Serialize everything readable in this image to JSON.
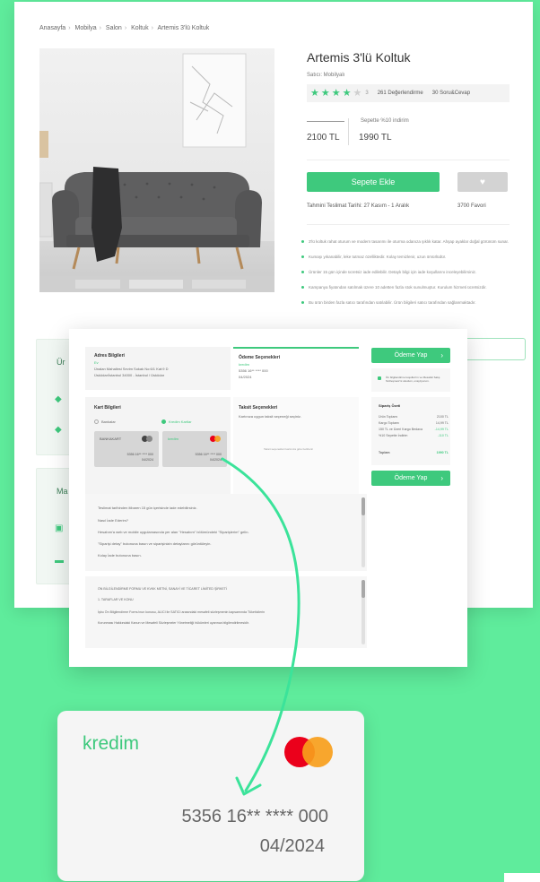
{
  "breadcrumb": [
    "Anasayfa",
    "Mobilya",
    "Salon",
    "Koltuk",
    "Artemis 3'lü Koltuk"
  ],
  "product": {
    "title": "Artemis 3'lü Koltuk",
    "seller": "Satıcı: Mobilyalı",
    "rating": 4,
    "rating_value": "3",
    "reviews_link": "261 Değerlendirme",
    "qa_link": "30 Soru&Cevap",
    "discount_label": "Sepette %10 indirim",
    "price_old": "2100 TL",
    "price_new": "1990 TL",
    "add_to_cart": "Sepete Ekle",
    "delivery": "Tahmini Teslimat Tarihi: 27 Kasım - 1 Aralık",
    "stock": "3700 Favori",
    "features": [
      "3'lü koltuk rahat oturum ve modern tasarımı ile oturma odanıza şıklık katar. Ahşap ayaklar doğal görünüm sunar.",
      "Kumaşı yıkanabilir, leke tutmaz özelliktedir. Kolay temizlenir, uzun ömürlüdür.",
      "Ürünler 15 gün içinde ücretsiz iade edilebilir. Detaylı bilgi için iade koşullarını inceleyebilirsiniz.",
      "Kampanya fiyatından satılmak üzere 10 adetten fazla stok sunulmuştur. Kurulum hizmeti ücretsizdir.",
      "Bu ürün birden fazla satıcı tarafından satılabilir. Ürün bilgileri satıcı tarafından sağlanmaktadır."
    ]
  },
  "side": {
    "box1_label": "Ür",
    "box2_label": "Ma"
  },
  "checkout": {
    "address_title": "Adres Bilgileri",
    "address_name": "Ev",
    "address_line1": "Ünalan Mahallesi Sevim Sokak No:6/1 Kat:9 D",
    "address_line2": "Üsküdar/İstanbul 34000 - İstanbul / Üsküdar",
    "payment_title": "Ödeme Seçenekleri",
    "payment_brand": "kredim",
    "payment_num": "5356 16** **** 000",
    "payment_date": "04/2024",
    "pay_button": "Ödeme Yap",
    "agree_text": "Ön bilgilendirme koşulları'nı ve Mesafeli Satış Sözleşmesi'ni okudum, onaylıyorum.",
    "card_title": "Kart Bilgileri",
    "opt1": "Bankalar",
    "opt2": "Kredim Kartlar",
    "cardA_brand": "BANKAKART",
    "cardA_num": "5356 16** **** 000",
    "cardA_date": "04/2024",
    "cardB_brand": "kredim",
    "cardB_num": "5356 16** **** 000",
    "cardB_date": "04/2024",
    "install_title": "Taksit Seçenekleri",
    "install_text": "Kartınıza uygun taksit seçeneği seçiniz.",
    "install_hint": "Taksit seçenekleri kartınıza göre belirlenir",
    "summary_title": "Sipariş Özeti",
    "summary_rows": [
      {
        "label": "Ürün Toplamı",
        "value": "2100 TL",
        "green": false
      },
      {
        "label": "Kargo Toplamı",
        "value": "14,99 TL",
        "green": false
      },
      {
        "label": "150 TL ve Üzeri Kargo Bedava",
        "value": "-14,99 TL",
        "green": true
      },
      {
        "label": "%10 Sepette İndirim",
        "value": "-110 TL",
        "green": true
      }
    ],
    "total_label": "Toplam",
    "total_value": "1990 TL",
    "info_lines": [
      "Teslimat tarihinden itibaren 15 gün içerisinde iade edebilirsiniz.",
      "Nasıl İade Ederim?",
      "Hesabım'a web ve mobile uygulamasında yer alan \"Hesabım\" bölümündeki \"Siparişlerim\" gelin.",
      "\"Siparişi detay\" butonuna basın ve siparişinizin detaylarını görüntüleyin.",
      "Kolay İade butonuna basın."
    ],
    "contract_lines": [
      "ÖN BİLGİLENDİRME FORMU VE KVKK METNİ, SANAYİ VE TİCARET LİMİTED ŞİRKETİ",
      "1. TARAFLAR VE KONU",
      "İşbu Ön Bilgilendirme Formu'nun konusu, ALICI ile SATICI arasındaki mesafeli sözleşmenin kapsamında Tüketicilerin",
      "Korunması Hakkındaki Kanun ve Mesafeli Sözleşmeler Yönetmeliği hükümleri uyarınca bilgilendirilmesidir."
    ]
  },
  "big_card": {
    "brand": "kredim",
    "number": "5356 16** **** 000",
    "date": "04/2024"
  },
  "colors": {
    "accent": "#3ec97d",
    "background": "#5fec9c",
    "mc_red": "#eb001b",
    "mc_orange": "#f79e1b"
  }
}
